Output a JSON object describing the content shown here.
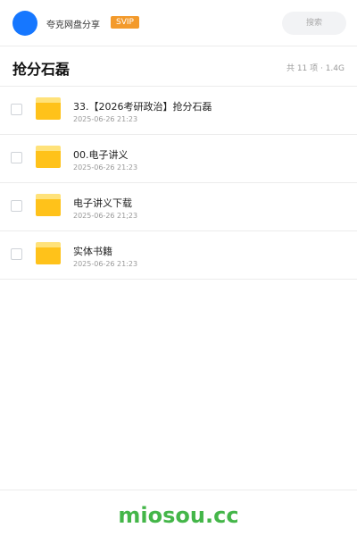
{
  "header": {
    "app_name": "夸克网盘分享",
    "badge": "SVIP",
    "search_placeholder": "搜索"
  },
  "folder": {
    "title": "抢分石磊",
    "meta": "共 11 项 · 1.4G"
  },
  "items": [
    {
      "name": "33.【2026考研政治】抢分石磊",
      "date": "2025-06-26 21:23",
      "icon": "folder-icon"
    },
    {
      "name": "00.电子讲义",
      "date": "2025-06-26 21:23",
      "icon": "folder-icon"
    },
    {
      "name": "电子讲义下载",
      "date": "2025-06-26 21;23",
      "icon": "folder-icon"
    },
    {
      "name": "实体书籍",
      "date": "2025-06-26 21:23",
      "icon": "folder-icon"
    }
  ],
  "footer": {
    "brand": "miosou.cc"
  },
  "colors": {
    "accent": "#1677ff",
    "badge": "#f39a2b",
    "folder": "#ffc21a",
    "brand": "#44b649"
  }
}
